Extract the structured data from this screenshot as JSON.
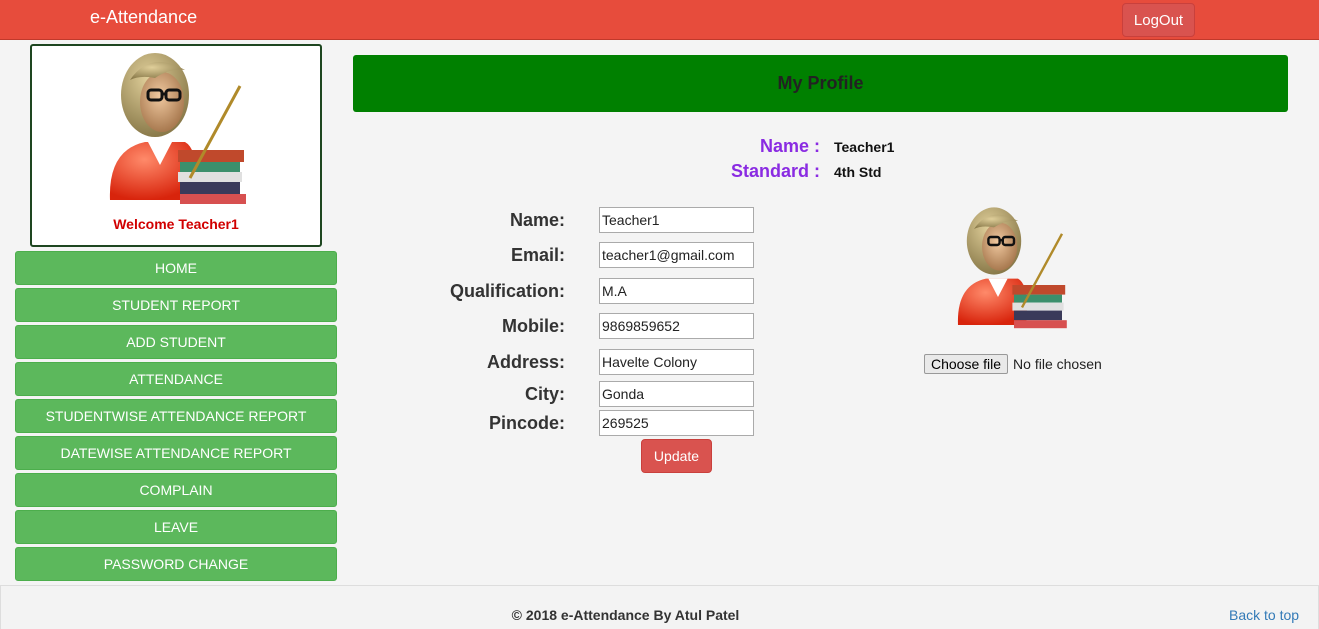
{
  "app": {
    "brand": "e-Attendance",
    "logout_label": "LogOut"
  },
  "profile_card": {
    "welcome": "Welcome Teacher1"
  },
  "menu": [
    {
      "label": "HOME"
    },
    {
      "label": "STUDENT REPORT"
    },
    {
      "label": "ADD STUDENT"
    },
    {
      "label": "ATTENDANCE"
    },
    {
      "label": "STUDENTWISE ATTENDANCE REPORT"
    },
    {
      "label": "DATEWISE ATTENDANCE REPORT"
    },
    {
      "label": "COMPLAIN"
    },
    {
      "label": "LEAVE"
    },
    {
      "label": "PASSWORD CHANGE"
    }
  ],
  "main": {
    "title": "My Profile",
    "summary": {
      "name_label": "Name :",
      "name_value": "Teacher1",
      "standard_label": "Standard :",
      "standard_value": "4th Std"
    },
    "form": {
      "fields": [
        {
          "label": "Name:",
          "value": "Teacher1"
        },
        {
          "label": "Email:",
          "value": "teacher1@gmail.com"
        },
        {
          "label": "Qualification:",
          "value": "M.A"
        },
        {
          "label": "Mobile:",
          "value": "9869859652"
        },
        {
          "label": "Address:",
          "value": "Havelte Colony"
        },
        {
          "label": "City:",
          "value": "Gonda"
        },
        {
          "label": "Pincode:",
          "value": "269525"
        }
      ],
      "update_label": "Update"
    },
    "file_input": {
      "button_label": "Choose file",
      "status": "No file chosen"
    }
  },
  "footer": {
    "copyright": "© 2018 e-Attendance By Atul Patel",
    "back_to_top": "Back to top"
  },
  "colors": {
    "topbar": "#e74c3c",
    "menu": "#5cb85c",
    "header": "#008000",
    "accent": "#8a2be2",
    "welcome": "#d10000"
  }
}
